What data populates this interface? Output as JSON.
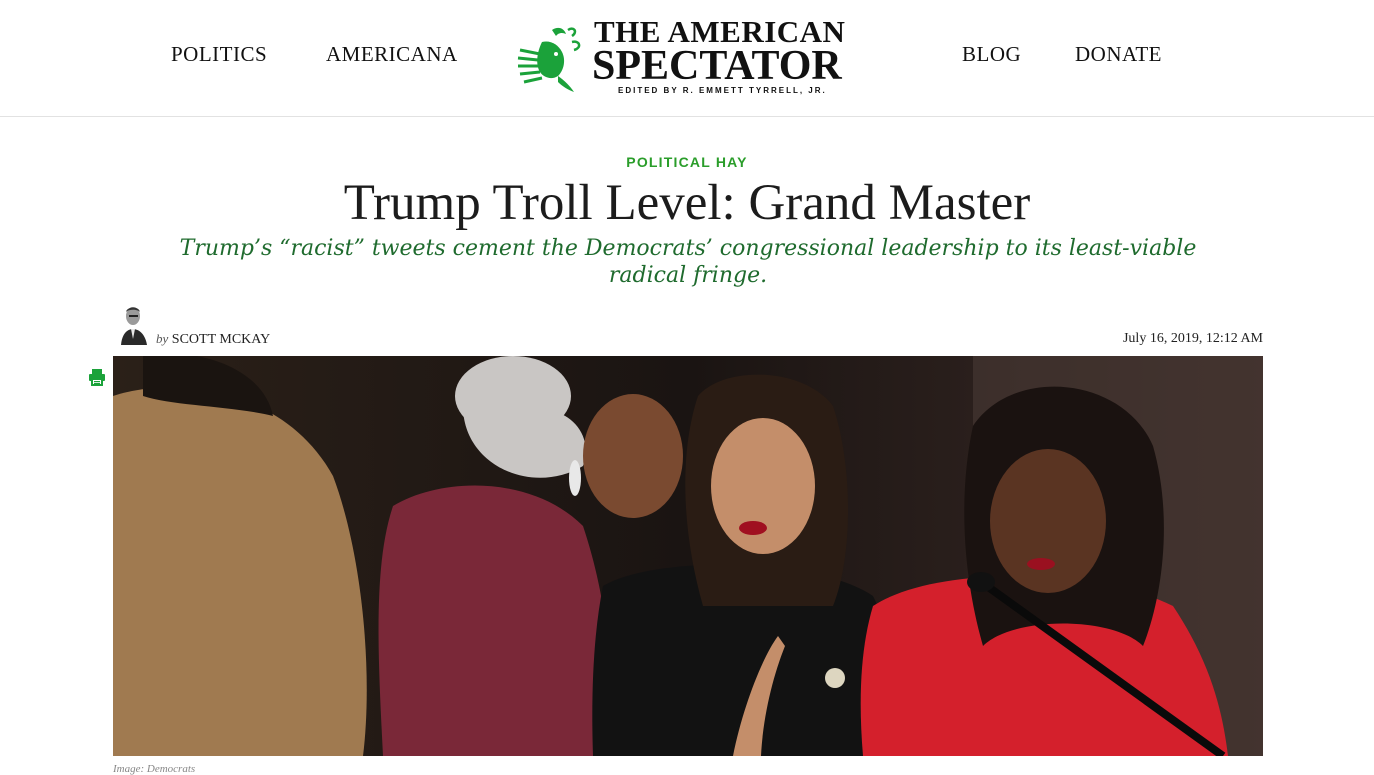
{
  "nav": {
    "left": [
      "POLITICS",
      "AMERICANA"
    ],
    "right": [
      "BLOG",
      "DONATE"
    ]
  },
  "logo": {
    "line1": "THE AMERICAN",
    "line2": "SPECTATOR",
    "line3": "EDITED BY R. EMMETT TYRRELL, JR.",
    "icon": "eagle-logo-icon",
    "accent_color": "#1ba23a"
  },
  "article": {
    "category": "POLITICAL HAY",
    "title": "Trump Troll Level: Grand Master",
    "subtitle": "Trump’s “racist” tweets cement the Democrats’ congressional leadership to its least-viable radical fringe.",
    "byline_prefix": "by",
    "author": "SCOTT MCKAY",
    "date": "July 16, 2019, 12:12 AM",
    "image_caption": "Image: Democrats",
    "print_icon": "print-icon"
  },
  "colors": {
    "category_green": "#2a9d2a",
    "subtitle_green": "#1f6b2e",
    "text": "#1c1c1c"
  }
}
